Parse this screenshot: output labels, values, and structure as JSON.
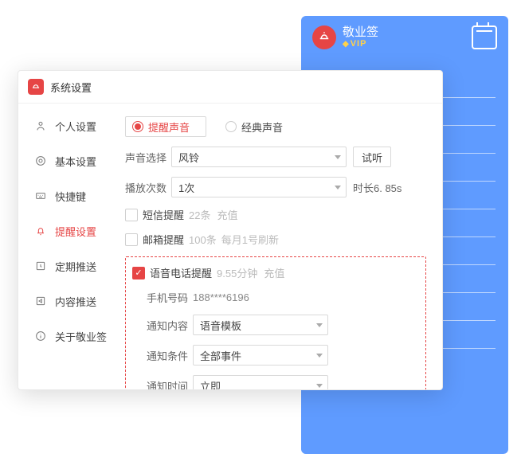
{
  "phone": {
    "app_name": "敬业签",
    "vip": "VIP"
  },
  "window": {
    "title": "系统设置"
  },
  "sidebar": {
    "items": [
      {
        "label": "个人设置"
      },
      {
        "label": "基本设置"
      },
      {
        "label": "快捷键"
      },
      {
        "label": "提醒设置"
      },
      {
        "label": "定期推送"
      },
      {
        "label": "内容推送"
      },
      {
        "label": "关于敬业签"
      }
    ]
  },
  "main": {
    "sound_type": {
      "reminder": "提醒声音",
      "classic": "经典声音"
    },
    "sound_select_label": "声音选择",
    "sound_value": "风铃",
    "preview_btn": "试听",
    "play_count_label": "播放次数",
    "play_count_value": "1次",
    "duration_note": "时长6. 85s",
    "sms": {
      "label": "短信提醒",
      "count": "22条",
      "recharge": "充值"
    },
    "email": {
      "label": "邮箱提醒",
      "count": "100条",
      "refresh": "每月1号刷新"
    },
    "voice": {
      "label": "语音电话提醒",
      "minutes": "9.55分钟",
      "recharge": "充值"
    },
    "phone_label": "手机号码",
    "phone_value": "188****6196",
    "content_label": "通知内容",
    "content_value": "语音模板",
    "cond_label": "通知条件",
    "cond_value": "全部事件",
    "time_label": "通知时间",
    "time_value": "立即"
  }
}
